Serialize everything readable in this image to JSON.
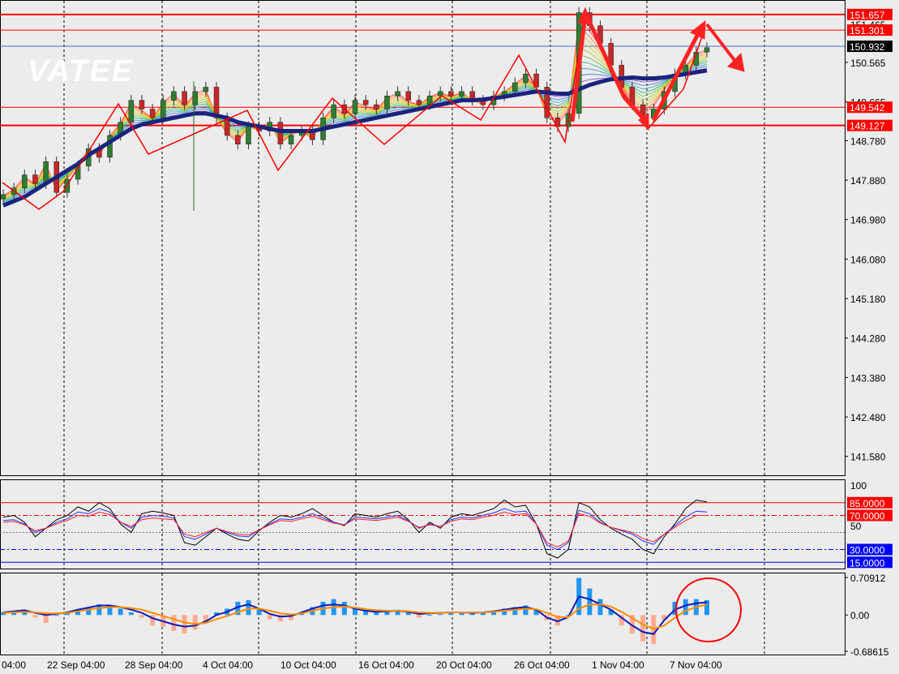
{
  "watermark": "VATEE",
  "colors": {
    "background": "#ececec",
    "red_level": "#ff0000",
    "blue_level": "#3b6fd6",
    "current_price_tag": "#000000",
    "ma_slow": "#1a237e",
    "rsi_black": "#000000",
    "rsi_blue": "#2233ff",
    "rsi_red": "#ff2222",
    "macd_pos_hist": "#2196f3",
    "macd_neg_hist": "#ffab91",
    "macd_line": "#0d1bb8",
    "macd_signal": "#ff8c00"
  },
  "chart_data": [
    {
      "type": "line",
      "name": "price-pane",
      "y_ticks": [
        "150.565",
        "149.665",
        "148.780",
        "147.880",
        "146.980",
        "146.080",
        "145.180",
        "144.280",
        "143.380",
        "142.480",
        "141.580"
      ],
      "ylim": [
        141.15,
        151.95
      ],
      "x_labels": [
        "04:00",
        "22 Sep 04:00",
        "28 Sep 04:00",
        "4 Oct 04:00",
        "10 Oct 04:00",
        "16 Oct 04:00",
        "20 Oct 04:00",
        "26 Oct 04:00",
        "1 Nov 04:00",
        "7 Nov 04:00"
      ],
      "levels": [
        {
          "value": 151.657,
          "label": "151.657",
          "kind": "red"
        },
        {
          "value": 151.301,
          "label": "151.301",
          "kind": "red"
        },
        {
          "value": 150.932,
          "label": "150.932",
          "kind": "current"
        },
        {
          "value": 149.542,
          "label": "149.542",
          "kind": "red"
        },
        {
          "value": 149.127,
          "label": "149.127",
          "kind": "red"
        }
      ],
      "partial_tick_text": "151.465",
      "close": [
        147.55,
        147.7,
        148.0,
        147.8,
        148.3,
        147.6,
        147.9,
        148.2,
        148.6,
        148.4,
        148.9,
        149.2,
        149.7,
        149.5,
        149.3,
        149.7,
        149.9,
        149.6,
        149.9,
        150.0,
        149.3,
        148.9,
        148.7,
        149.1,
        149.0,
        149.2,
        148.7,
        148.9,
        149.0,
        148.8,
        149.3,
        149.6,
        149.4,
        149.7,
        149.6,
        149.5,
        149.8,
        149.9,
        149.7,
        149.6,
        149.8,
        149.9,
        149.8,
        149.9,
        149.7,
        149.6,
        149.8,
        149.9,
        150.1,
        150.3,
        150.0,
        149.3,
        149.1,
        149.4,
        151.7,
        151.4,
        151.0,
        150.5,
        150.0,
        149.6,
        149.3,
        149.5,
        149.9,
        150.3,
        150.5,
        150.8,
        150.9
      ],
      "ma_slow": [
        147.3,
        147.4,
        147.5,
        147.65,
        147.8,
        147.95,
        148.1,
        148.25,
        148.45,
        148.6,
        148.75,
        148.9,
        149.05,
        149.15,
        149.2,
        149.25,
        149.3,
        149.35,
        149.4,
        149.4,
        149.35,
        149.3,
        149.2,
        149.15,
        149.1,
        149.05,
        149.0,
        149.0,
        149.0,
        149.0,
        149.05,
        149.1,
        149.15,
        149.2,
        149.25,
        149.3,
        149.35,
        149.4,
        149.45,
        149.5,
        149.55,
        149.6,
        149.65,
        149.7,
        149.7,
        149.72,
        149.75,
        149.78,
        149.82,
        149.86,
        149.9,
        149.88,
        149.85,
        149.85,
        149.95,
        150.05,
        150.12,
        150.18,
        150.2,
        150.22,
        150.2,
        150.2,
        150.22,
        150.26,
        150.3,
        150.34,
        150.38
      ]
    },
    {
      "type": "line",
      "name": "rsi-pane",
      "ylim": [
        0,
        100
      ],
      "y_tick_labels": [
        "100",
        "50"
      ],
      "levels": [
        {
          "value": 85,
          "label": "85.0000",
          "style": "solid-red"
        },
        {
          "value": 70,
          "label": "70.0000",
          "style": "dashdot-red"
        },
        {
          "value": 50,
          "label": "",
          "style": "dotted-gray"
        },
        {
          "value": 30,
          "label": "30.0000",
          "style": "dashdot-blue"
        },
        {
          "value": 15,
          "label": "15.0000",
          "style": "solid-blue"
        }
      ],
      "series": [
        {
          "values": [
            68,
            70,
            62,
            45,
            55,
            65,
            70,
            80,
            75,
            85,
            78,
            60,
            50,
            72,
            75,
            73,
            70,
            38,
            35,
            45,
            55,
            48,
            42,
            40,
            52,
            62,
            70,
            68,
            72,
            78,
            70,
            62,
            58,
            72,
            70,
            68,
            72,
            75,
            65,
            50,
            62,
            55,
            68,
            72,
            70,
            74,
            78,
            88,
            80,
            82,
            60,
            25,
            20,
            30,
            85,
            80,
            65,
            55,
            48,
            42,
            30,
            25,
            45,
            60,
            78,
            88,
            86
          ]
        },
        {
          "values": [
            64,
            65,
            60,
            50,
            55,
            62,
            66,
            74,
            72,
            78,
            74,
            62,
            55,
            68,
            70,
            69,
            67,
            45,
            42,
            48,
            55,
            50,
            46,
            45,
            53,
            60,
            66,
            65,
            68,
            72,
            67,
            62,
            59,
            68,
            67,
            66,
            68,
            70,
            64,
            55,
            60,
            57,
            65,
            68,
            67,
            70,
            73,
            78,
            74,
            75,
            60,
            35,
            30,
            38,
            76,
            72,
            62,
            56,
            52,
            48,
            40,
            36,
            48,
            58,
            68,
            75,
            74
          ]
        },
        {
          "values": [
            62,
            63,
            59,
            52,
            55,
            60,
            64,
            70,
            69,
            74,
            71,
            62,
            57,
            65,
            67,
            66,
            65,
            48,
            45,
            50,
            55,
            51,
            48,
            47,
            53,
            59,
            64,
            63,
            66,
            69,
            65,
            61,
            59,
            66,
            65,
            64,
            66,
            68,
            63,
            56,
            59,
            57,
            63,
            66,
            65,
            68,
            70,
            74,
            71,
            72,
            60,
            38,
            33,
            40,
            72,
            69,
            61,
            56,
            53,
            50,
            43,
            39,
            48,
            56,
            64,
            70,
            70
          ]
        }
      ]
    },
    {
      "type": "bar",
      "name": "macd-pane",
      "y_tick_labels": [
        "0.70912",
        "0.00",
        "-0.68615"
      ],
      "ylim": [
        -0.68615,
        0.70912
      ],
      "histogram": [
        0.05,
        0.08,
        0.1,
        -0.05,
        -0.15,
        0.0,
        0.05,
        0.1,
        0.15,
        0.2,
        0.18,
        0.12,
        0.05,
        -0.05,
        -0.2,
        -0.22,
        -0.3,
        -0.35,
        -0.28,
        -0.15,
        0.05,
        0.12,
        0.25,
        0.28,
        0.1,
        -0.08,
        -0.12,
        -0.1,
        0.05,
        0.15,
        0.25,
        0.3,
        0.25,
        0.15,
        0.08,
        0.05,
        0.08,
        0.1,
        0.05,
        -0.05,
        0.0,
        0.02,
        0.05,
        0.05,
        0.03,
        0.05,
        0.08,
        0.12,
        0.15,
        0.18,
        0.1,
        -0.1,
        -0.2,
        0.0,
        0.7,
        0.5,
        0.3,
        0.1,
        -0.2,
        -0.35,
        -0.5,
        -0.55,
        -0.1,
        0.25,
        0.3,
        0.3,
        0.28
      ],
      "series": [
        {
          "values": [
            0.05,
            0.07,
            0.09,
            0.04,
            0.0,
            0.02,
            0.05,
            0.1,
            0.14,
            0.18,
            0.18,
            0.15,
            0.1,
            0.04,
            -0.06,
            -0.12,
            -0.18,
            -0.22,
            -0.2,
            -0.12,
            0.0,
            0.06,
            0.15,
            0.2,
            0.12,
            0.02,
            -0.03,
            -0.02,
            0.05,
            0.12,
            0.18,
            0.2,
            0.18,
            0.12,
            0.08,
            0.06,
            0.07,
            0.08,
            0.06,
            0.02,
            0.03,
            0.04,
            0.05,
            0.05,
            0.04,
            0.05,
            0.07,
            0.1,
            0.13,
            0.15,
            0.1,
            -0.05,
            -0.12,
            -0.04,
            0.35,
            0.3,
            0.2,
            0.1,
            -0.05,
            -0.2,
            -0.32,
            -0.36,
            -0.1,
            0.1,
            0.18,
            0.22,
            0.24
          ]
        },
        {
          "values": [
            0.04,
            0.05,
            0.06,
            0.05,
            0.03,
            0.03,
            0.04,
            0.07,
            0.1,
            0.13,
            0.15,
            0.15,
            0.13,
            0.1,
            0.04,
            -0.02,
            -0.08,
            -0.14,
            -0.17,
            -0.15,
            -0.08,
            -0.02,
            0.05,
            0.12,
            0.12,
            0.08,
            0.03,
            0.01,
            0.03,
            0.08,
            0.12,
            0.15,
            0.16,
            0.14,
            0.11,
            0.09,
            0.08,
            0.08,
            0.07,
            0.05,
            0.04,
            0.04,
            0.05,
            0.05,
            0.05,
            0.05,
            0.06,
            0.08,
            0.1,
            0.12,
            0.11,
            0.04,
            -0.04,
            -0.04,
            0.12,
            0.2,
            0.2,
            0.16,
            0.06,
            -0.06,
            -0.18,
            -0.26,
            -0.2,
            -0.05,
            0.08,
            0.15,
            0.2
          ]
        }
      ]
    }
  ]
}
